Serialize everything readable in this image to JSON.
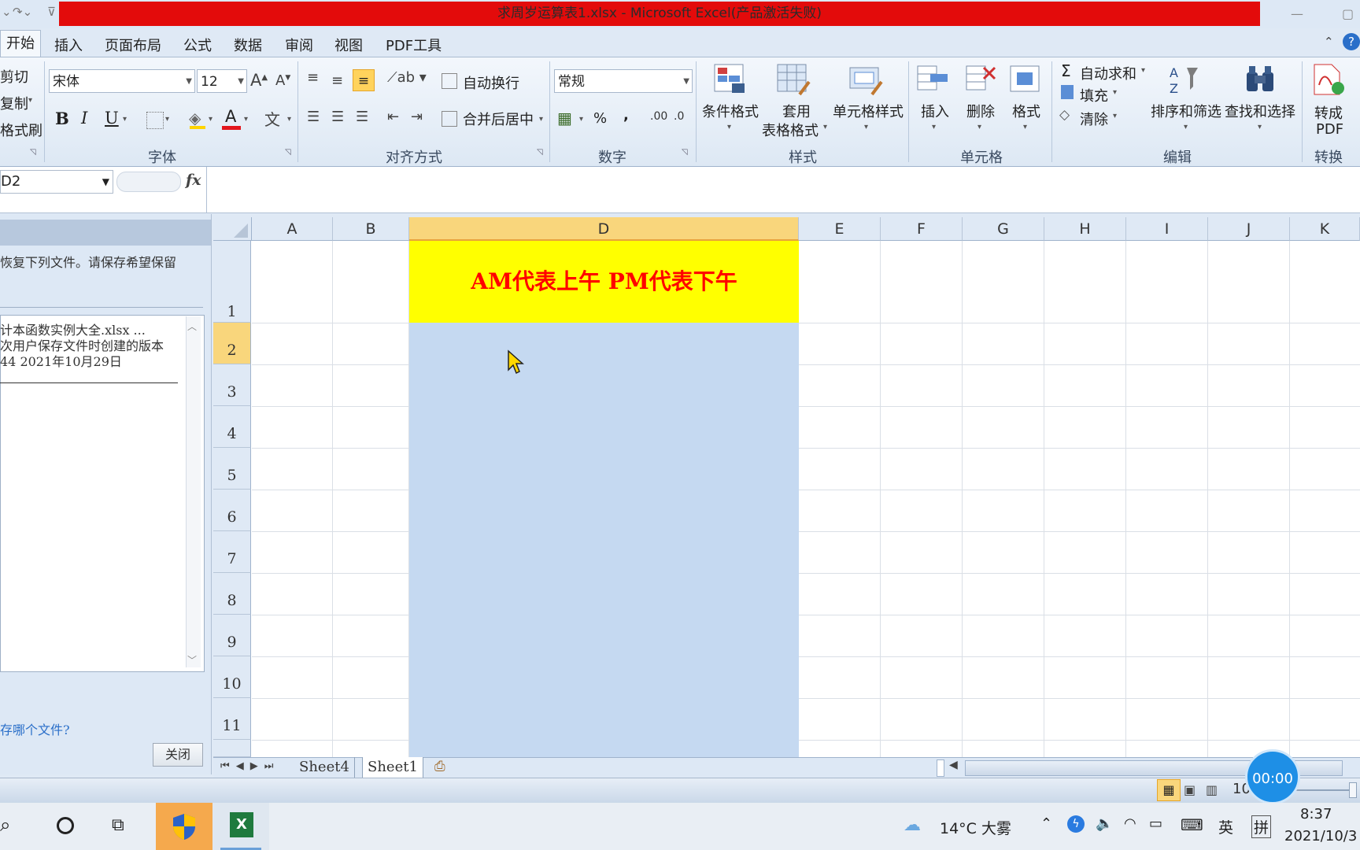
{
  "window": {
    "title": "求周岁运算表1.xlsx - Microsoft Excel(产品激活失败)"
  },
  "menu": {
    "tabs": [
      "开始",
      "插入",
      "页面布局",
      "公式",
      "数据",
      "审阅",
      "视图",
      "PDF工具"
    ]
  },
  "ribbon": {
    "clipboard": {
      "cut": "剪切",
      "copy": "复制",
      "format_painter": "格式刷"
    },
    "font": {
      "name": "宋体",
      "size": "12",
      "group_label": "字体",
      "bold": "B",
      "italic": "I",
      "underline": "U",
      "color_letter": "A"
    },
    "alignment": {
      "wrap": "自动换行",
      "merge": "合并后居中",
      "group_label": "对齐方式"
    },
    "number": {
      "format": "常规",
      "percent": "%",
      "comma": ",",
      "group_label": "数字"
    },
    "styles": {
      "conditional": "条件格式",
      "table_line1": "套用",
      "table_line2": "表格格式",
      "cell_styles": "单元格样式",
      "group_label": "样式"
    },
    "cells": {
      "insert": "插入",
      "delete": "删除",
      "format": "格式",
      "group_label": "单元格"
    },
    "editing": {
      "autosum": "自动求和",
      "fill": "填充",
      "clear": "清除",
      "sort": "排序和筛选",
      "find": "查找和选择",
      "group_label": "编辑"
    },
    "convert": {
      "line1": "转成",
      "line2": "PDF",
      "group_label": "转换"
    }
  },
  "formula_bar": {
    "name_box": "D2",
    "fx": "fx",
    "value": ""
  },
  "recovery_pane": {
    "intro": "恢复下列文件。请保存希望保留",
    "file_name": "计本函数实例大全.xlsx  ...",
    "file_desc": "次用户保存文件时创建的版本",
    "file_time": "44 2021年10月29日",
    "question": "存哪个文件?",
    "close": "关闭"
  },
  "sheet": {
    "columns": [
      "A",
      "B",
      "D",
      "E",
      "F",
      "G",
      "H",
      "I",
      "J",
      "K"
    ],
    "rows": [
      "1",
      "2",
      "3",
      "4",
      "5",
      "6",
      "7",
      "8",
      "9",
      "10",
      "11"
    ],
    "cell_D1": "AM代表上午 PM代表下午",
    "colors": {
      "header_fill": "#ffff00",
      "header_text": "#ff0000",
      "selection": "#c5d9f1"
    }
  },
  "sheet_tabs": [
    "Sheet4",
    "Sheet1"
  ],
  "status": {
    "zoom": "10",
    "timer": "00:00"
  },
  "taskbar": {
    "weather": "14°C 大雾",
    "ime_lang": "英",
    "ime_mode": "拼",
    "time": "8:37",
    "date": "2021/10/3"
  }
}
